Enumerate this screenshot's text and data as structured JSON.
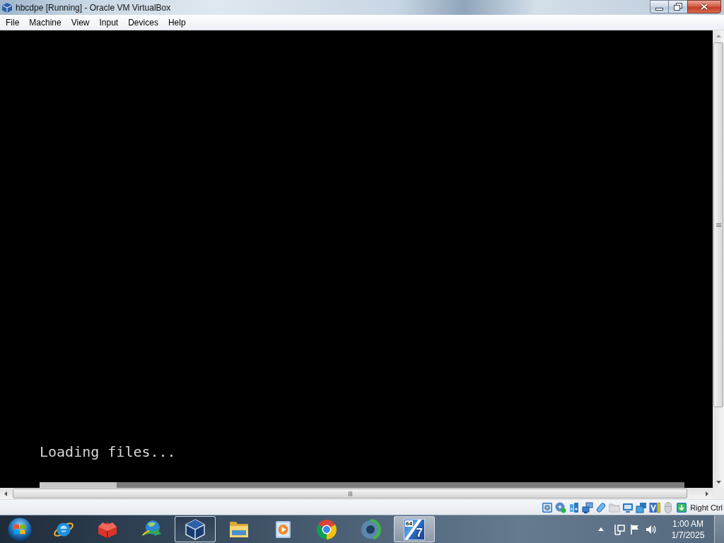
{
  "window": {
    "title": "hbcdpe [Running] - Oracle VM VirtualBox"
  },
  "menu": [
    "File",
    "Machine",
    "View",
    "Input",
    "Devices",
    "Help"
  ],
  "vm_screen": {
    "message": "Loading files...",
    "progress": {
      "level": 0.12
    }
  },
  "status_bar": {
    "indicators": [
      {
        "kind": "hard-disk",
        "disabled": false
      },
      {
        "kind": "optical-disc",
        "disabled": false
      },
      {
        "kind": "audio",
        "disabled": false
      },
      {
        "kind": "network",
        "disabled": false
      },
      {
        "kind": "usb",
        "disabled": false
      },
      {
        "kind": "shared-folder",
        "disabled": true
      },
      {
        "kind": "display",
        "disabled": false
      },
      {
        "kind": "recording",
        "disabled": false
      },
      {
        "kind": "features",
        "disabled": false
      },
      {
        "kind": "mouse",
        "disabled": true
      },
      {
        "kind": "keyboard",
        "disabled": false
      }
    ],
    "host_key": "Right Ctrl"
  },
  "taskbar": {
    "apps": [
      {
        "kind": "browser",
        "running": false,
        "selected": false
      },
      {
        "kind": "red-box",
        "running": false,
        "selected": false
      },
      {
        "kind": "downloader",
        "running": false,
        "selected": false
      },
      {
        "kind": "virtualbox",
        "running": true,
        "selected": true
      },
      {
        "kind": "explorer",
        "running": false,
        "selected": false
      },
      {
        "kind": "media",
        "running": false,
        "selected": false
      },
      {
        "kind": "chrome",
        "running": false,
        "selected": false
      },
      {
        "kind": "swirl",
        "running": false,
        "selected": false
      },
      {
        "kind": "tile",
        "running": true,
        "selected": false,
        "badge": "64",
        "glyph": "7"
      }
    ],
    "clock": {
      "time": "1:00 AM",
      "date": "1/7/2025"
    }
  }
}
